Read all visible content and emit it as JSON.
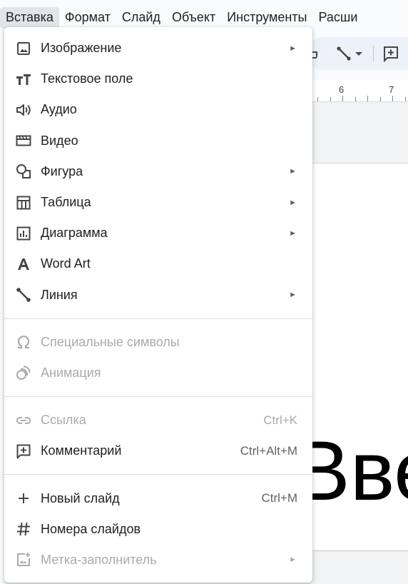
{
  "menubar": {
    "items": [
      {
        "label": "Вставка"
      },
      {
        "label": "Формат"
      },
      {
        "label": "Слайд"
      },
      {
        "label": "Объект"
      },
      {
        "label": "Инструменты"
      },
      {
        "label": "Расши"
      }
    ]
  },
  "ruler": {
    "n6": "6",
    "n7": "7"
  },
  "slide": {
    "big_text": "Вве"
  },
  "menu": {
    "image": {
      "label": "Изображение",
      "icon": "image-icon",
      "arrow": "►"
    },
    "textbox": {
      "label": "Текстовое поле",
      "icon": "text-box-icon"
    },
    "audio": {
      "label": "Аудио",
      "icon": "audio-icon"
    },
    "video": {
      "label": "Видео",
      "icon": "video-icon"
    },
    "shape": {
      "label": "Фигура",
      "icon": "shape-icon",
      "arrow": "►"
    },
    "table": {
      "label": "Таблица",
      "icon": "table-icon",
      "arrow": "►"
    },
    "chart": {
      "label": "Диаграмма",
      "icon": "chart-icon",
      "arrow": "►"
    },
    "wordart": {
      "label": "Word Art",
      "icon": "word-art-icon"
    },
    "line": {
      "label": "Линия",
      "icon": "line-icon",
      "arrow": "►"
    },
    "special_chars": {
      "label": "Специальные символы",
      "icon": "omega-icon"
    },
    "animation": {
      "label": "Анимация",
      "icon": "animation-icon"
    },
    "link": {
      "label": "Ссылка",
      "icon": "link-icon",
      "shortcut": "Ctrl+K"
    },
    "comment": {
      "label": "Комментарий",
      "icon": "add-comment-icon",
      "shortcut": "Ctrl+Alt+M"
    },
    "new_slide": {
      "label": "Новый слайд",
      "icon": "plus-icon",
      "shortcut": "Ctrl+M"
    },
    "slide_numbers": {
      "label": "Номера слайдов",
      "icon": "hash-icon"
    },
    "placeholder": {
      "label": "Метка-заполнитель",
      "icon": "placeholder-icon",
      "arrow": "►"
    }
  },
  "colors": {
    "text": "#202124",
    "icon": "#444746",
    "disabled": "#a8abae",
    "active_menu_bg": "#e1e5ea",
    "toolbar_bg": "#edf2fa"
  }
}
